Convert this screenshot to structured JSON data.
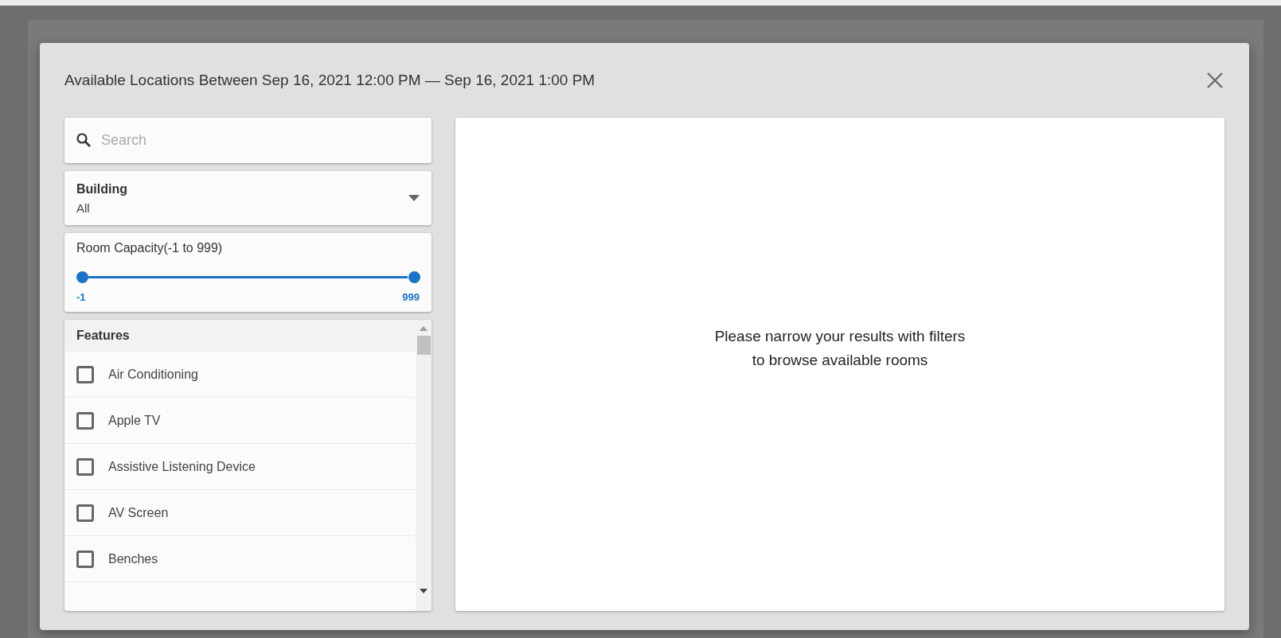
{
  "dialog": {
    "title": "Available Locations Between Sep 16, 2021 12:00 PM — Sep 16, 2021 1:00 PM"
  },
  "search": {
    "placeholder": "Search"
  },
  "building": {
    "label": "Building",
    "value": "All"
  },
  "capacity": {
    "label": "Room Capacity(-1 to 999)",
    "thumbs": [
      {
        "level": 0,
        "reading": "-1"
      },
      {
        "level": 1,
        "reading": "999"
      }
    ]
  },
  "features": {
    "title": "Features",
    "items": [
      {
        "label": "Air Conditioning",
        "checked": false
      },
      {
        "label": "Apple TV",
        "checked": false
      },
      {
        "label": "Assistive Listening Device",
        "checked": false
      },
      {
        "label": "AV Screen",
        "checked": false
      },
      {
        "label": "Benches",
        "checked": false
      }
    ]
  },
  "results": {
    "message_lines": [
      "Please narrow your results with filters",
      "to browse available rooms"
    ]
  }
}
